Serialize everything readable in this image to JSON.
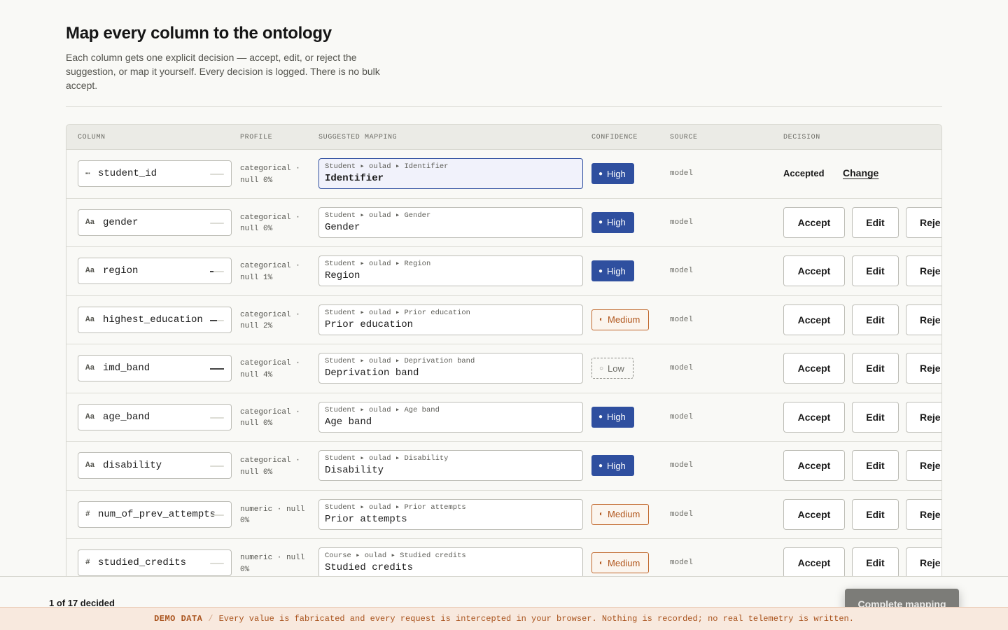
{
  "header": {
    "title": "Map every column to the ontology",
    "subtitle": "Each column gets one explicit decision — accept, edit, or reject the suggestion, or map it yourself. Every decision is logged. There is no bulk accept."
  },
  "table": {
    "columns": [
      "COLUMN",
      "PROFILE",
      "SUGGESTED MAPPING",
      "CONFIDENCE",
      "SOURCE",
      "DECISION"
    ],
    "actions": {
      "accept": "Accept",
      "edit": "Edit",
      "reject": "Reje"
    },
    "rows": [
      {
        "type_icon": "⋯",
        "column": "student_id",
        "null_fill": 0,
        "profile": "categorical · null 0%",
        "path": "Student ▸ oulad ▸ Identifier",
        "term": "Identifier",
        "confidence": "High",
        "confidence_dot": "●",
        "source": "model",
        "decided": true,
        "decision_label": "Accepted",
        "change_label": "Change"
      },
      {
        "type_icon": "Aa",
        "column": "gender",
        "null_fill": 0,
        "profile": "categorical · null 0%",
        "path": "Student ▸ oulad ▸ Gender",
        "term": "Gender",
        "confidence": "High",
        "confidence_dot": "●",
        "source": "model",
        "decided": false
      },
      {
        "type_icon": "Aa",
        "column": "region",
        "null_fill": 0.01,
        "profile": "categorical · null 1%",
        "path": "Student ▸ oulad ▸ Region",
        "term": "Region",
        "confidence": "High",
        "confidence_dot": "●",
        "source": "model",
        "decided": false
      },
      {
        "type_icon": "Aa",
        "column": "highest_education",
        "null_fill": 0.02,
        "profile": "categorical · null 2%",
        "path": "Student ▸ oulad ▸ Prior education",
        "term": "Prior education",
        "confidence": "Medium",
        "confidence_dot": "◐",
        "source": "model",
        "decided": false
      },
      {
        "type_icon": "Aa",
        "column": "imd_band",
        "null_fill": 0.04,
        "profile": "categorical · null 4%",
        "path": "Student ▸ oulad ▸ Deprivation band",
        "term": "Deprivation band",
        "confidence": "Low",
        "confidence_dot": "○",
        "source": "model",
        "decided": false
      },
      {
        "type_icon": "Aa",
        "column": "age_band",
        "null_fill": 0,
        "profile": "categorical · null 0%",
        "path": "Student ▸ oulad ▸ Age band",
        "term": "Age band",
        "confidence": "High",
        "confidence_dot": "●",
        "source": "model",
        "decided": false
      },
      {
        "type_icon": "Aa",
        "column": "disability",
        "null_fill": 0,
        "profile": "categorical · null 0%",
        "path": "Student ▸ oulad ▸ Disability",
        "term": "Disability",
        "confidence": "High",
        "confidence_dot": "●",
        "source": "model",
        "decided": false
      },
      {
        "type_icon": "#",
        "column": "num_of_prev_attempts",
        "null_fill": 0,
        "profile": "numeric · null 0%",
        "path": "Student ▸ oulad ▸ Prior attempts",
        "term": "Prior attempts",
        "confidence": "Medium",
        "confidence_dot": "◐",
        "source": "model",
        "decided": false
      },
      {
        "type_icon": "#",
        "column": "studied_credits",
        "null_fill": 0,
        "profile": "numeric · null 0%",
        "path": "Course ▸ oulad ▸ Studied credits",
        "term": "Studied credits",
        "confidence": "Medium",
        "confidence_dot": "◐",
        "source": "model",
        "decided": false
      }
    ]
  },
  "footer": {
    "progress": "1 of 17 decided",
    "complete_label": "Complete mapping"
  },
  "banner": {
    "tag": "DEMO DATA",
    "separator": "/",
    "message": "Every value is fabricated and every request is intercepted in your browser. Nothing is recorded; no real telemetry is written."
  },
  "colors": {
    "high": "#2f4f9f",
    "medium": "#c0662a",
    "low": "#8a8a84",
    "banner_bg": "#f8e9de"
  }
}
